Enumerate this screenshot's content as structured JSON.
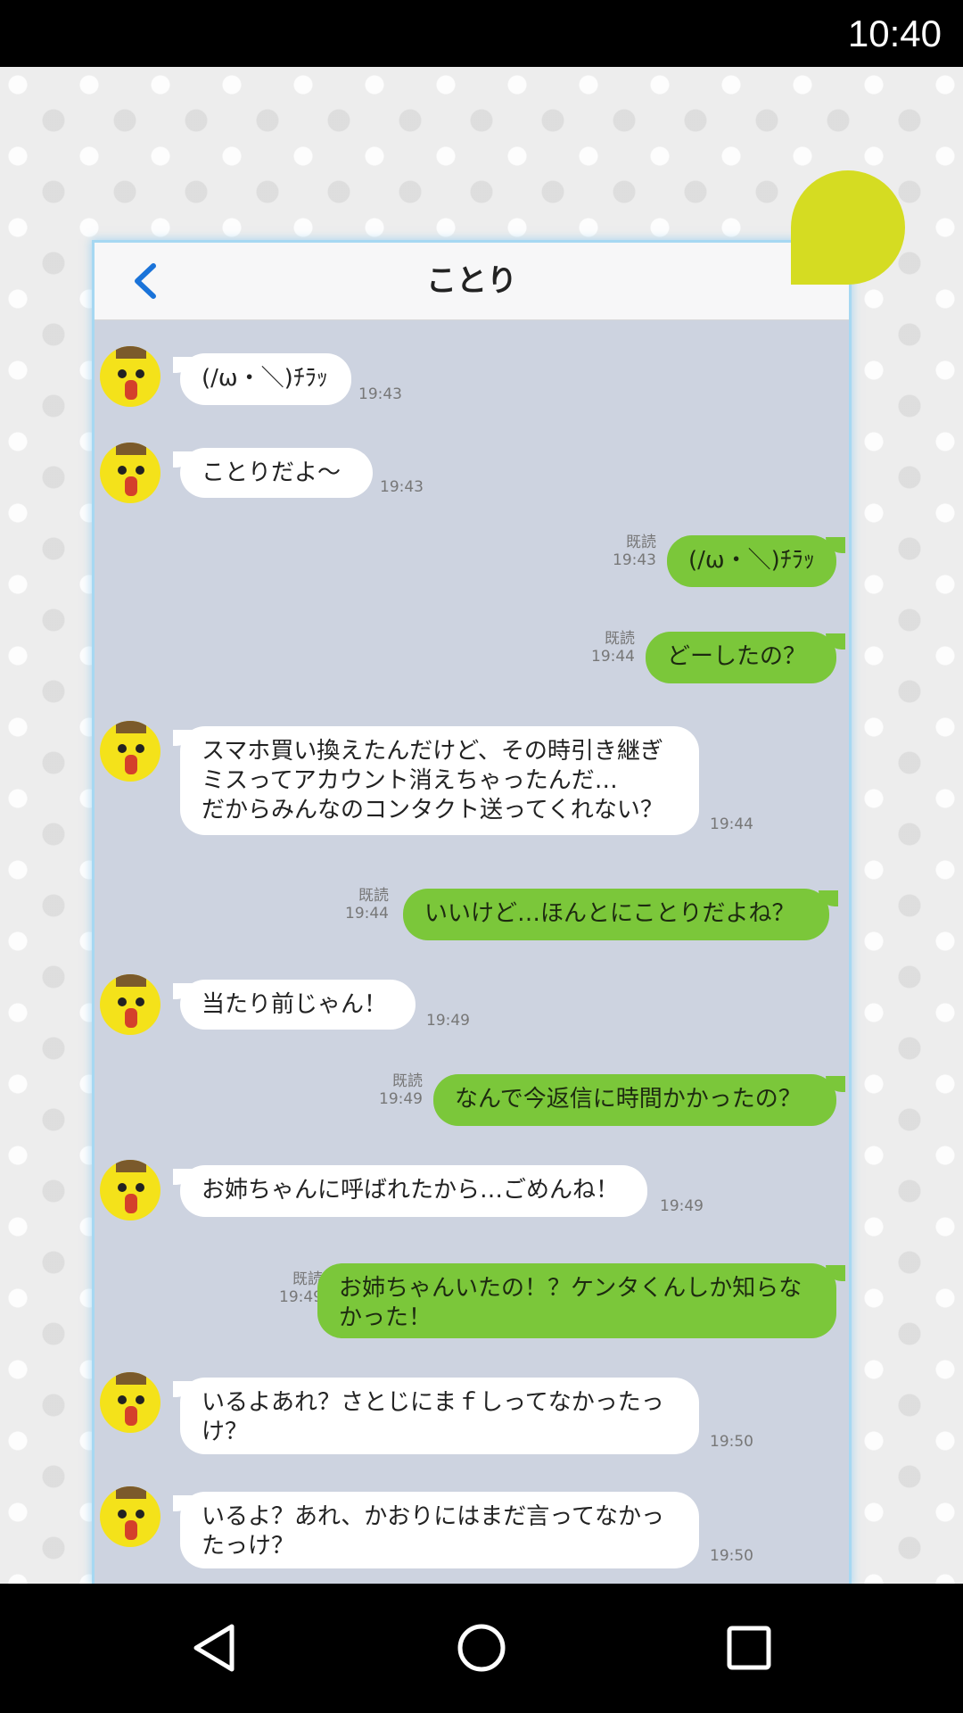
{
  "status": {
    "time": "10:40"
  },
  "chat": {
    "title": "ことり"
  },
  "messages": [
    {
      "side": "in",
      "text": "(/ω・＼)ﾁﾗｯ",
      "time": "19:43"
    },
    {
      "side": "in",
      "text": "ことりだよ〜",
      "time": "19:43"
    },
    {
      "side": "out",
      "text": "(/ω・＼)ﾁﾗｯ",
      "read": "既読",
      "time": "19:43"
    },
    {
      "side": "out",
      "text": "どーしたの？",
      "read": "既読",
      "time": "19:44"
    },
    {
      "side": "in",
      "text": "スマホ買い換えたんだけど、その時引き継ぎ\nミスってアカウント消えちゃったんだ…\nだからみんなのコンタクト送ってくれない？",
      "time": "19:44"
    },
    {
      "side": "out",
      "text": "いいけど…ほんとにことりだよね？",
      "read": "既読",
      "time": "19:44"
    },
    {
      "side": "in",
      "text": "当たり前じゃん！",
      "time": "19:49"
    },
    {
      "side": "out",
      "text": "なんで今返信に時間かかったの？",
      "read": "既読",
      "time": "19:49"
    },
    {
      "side": "in",
      "text": "お姉ちゃんに呼ばれたから…ごめんね！",
      "time": "19:49"
    },
    {
      "side": "out",
      "text": "お姉ちゃんいたの！？ケンタくんしか知らな\nかった！",
      "read": "既読",
      "time": "19:49"
    },
    {
      "side": "in",
      "text": "いるよあれ？さとじにまｆしってなかったっ\nけ？",
      "time": "19:50"
    },
    {
      "side": "in",
      "text": "いるよ？あれ、かおりにはまだ言ってなかっ\nたっけ？",
      "time": "19:50"
    }
  ],
  "colors": {
    "incoming": "#ffffff",
    "outgoing": "#7bc73a",
    "chat_bg": "#cdd3e0",
    "accent": "#d5dc22"
  },
  "nav": {
    "icons": [
      "back-triangle-icon",
      "home-circle-icon",
      "recents-square-icon"
    ]
  }
}
